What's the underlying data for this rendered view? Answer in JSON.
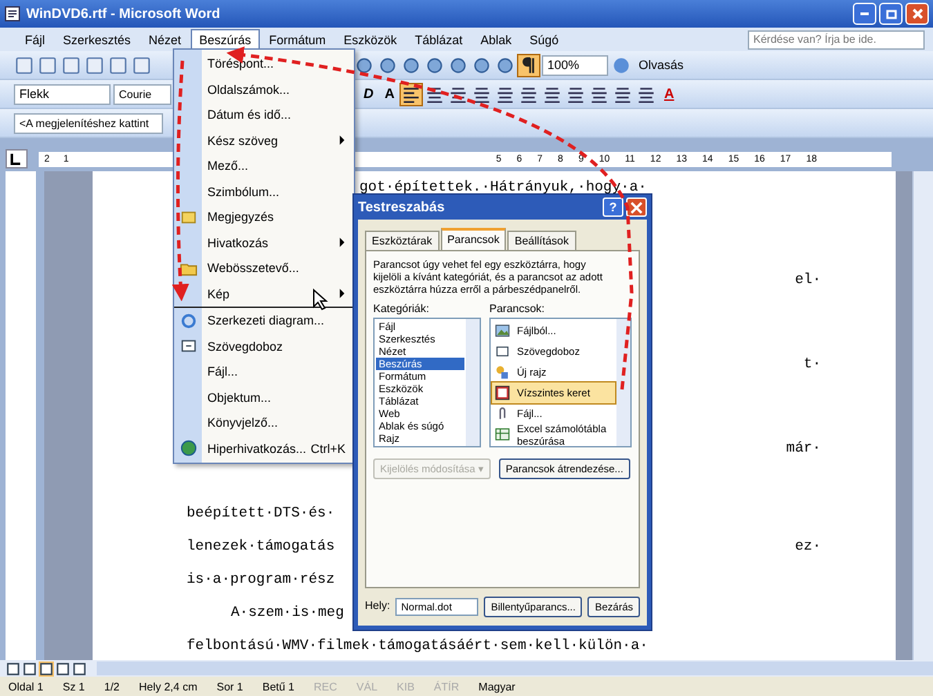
{
  "window": {
    "title": "WinDVD6.rtf - Microsoft Word"
  },
  "menu_bar": {
    "items": [
      {
        "label": "Fájl",
        "selected": false
      },
      {
        "label": "Szerkesztés",
        "selected": false
      },
      {
        "label": "Nézet",
        "selected": false
      },
      {
        "label": "Beszúrás",
        "selected": true
      },
      {
        "label": "Formátum",
        "selected": false
      },
      {
        "label": "Eszközök",
        "selected": false
      },
      {
        "label": "Táblázat",
        "selected": false
      },
      {
        "label": "Ablak",
        "selected": false
      },
      {
        "label": "Súgó",
        "selected": false
      }
    ],
    "ask_box": {
      "placeholder": "Kérdése van? Írja be ide."
    }
  },
  "standard_toolbar": {
    "zoom": "100%",
    "reading_button": "Olvasás",
    "show_marks_on": true
  },
  "formatting_toolbar": {
    "style": "Flekk",
    "font": "Courie",
    "italic": "D",
    "underline": "A",
    "align_left_on": true,
    "font_color": "A"
  },
  "toolbar_3": {
    "field": "<A megjelenítéshez kattint"
  },
  "ruler": {
    "left_labels": [
      "2",
      "1"
    ],
    "right_labels": [
      "5",
      "6",
      "7",
      "8",
      "9",
      "10",
      "11",
      "12",
      "13",
      "14",
      "15",
      "16",
      "17",
      "18"
    ]
  },
  "document": {
    "first_line": "got·építettek.·Hátrányuk,·hogy·a·",
    "right_fragments": [
      "el·",
      "t·",
      "már·"
    ],
    "lines": [
      {
        "kind": "text",
        "text": "beépített·DTS·és·"
      },
      {
        "kind": "text",
        "text": "lenezek·támogatás",
        "tail": "ez·"
      },
      {
        "kind": "text",
        "text": "is·a·program·rész"
      },
      {
        "kind": "indent",
        "text": "A·szem·is·meg"
      },
      {
        "kind": "text",
        "text": "felbontású·WMV·filmek·támogatásáért·sem·kell·külön·a·"
      }
    ]
  },
  "insert_menu": {
    "items": [
      {
        "label": "Töréspont...",
        "submenu": false
      },
      {
        "label": "Oldalszámok...",
        "submenu": false
      },
      {
        "label": "Dátum és idő...",
        "submenu": false
      },
      {
        "label": "Kész szöveg",
        "submenu": true
      },
      {
        "label": "Mező...",
        "submenu": false
      },
      {
        "label": "Szimbólum...",
        "submenu": false
      },
      {
        "label": "Megjegyzés",
        "submenu": false
      },
      {
        "label": "Hivatkozás",
        "submenu": true
      },
      {
        "label": "Webösszetevő...",
        "submenu": false
      },
      {
        "label": "Kép",
        "submenu": true
      },
      {
        "label": "Szerkezeti diagram...",
        "submenu": false
      },
      {
        "label": "Szövegdoboz",
        "submenu": false
      },
      {
        "label": "Fájl...",
        "submenu": false
      },
      {
        "label": "Objektum...",
        "submenu": false
      },
      {
        "label": "Könyvjelző...",
        "submenu": false
      },
      {
        "label": "Hiperhivatkozás...",
        "submenu": false,
        "shortcut": "Ctrl+K"
      }
    ]
  },
  "dialog": {
    "title": "Testreszabás",
    "help_button": "?",
    "tabs": [
      {
        "label": "Eszköztárak",
        "selected": false
      },
      {
        "label": "Parancsok",
        "selected": true
      },
      {
        "label": "Beállítások",
        "selected": false
      }
    ],
    "instructions": "Parancsot úgy vehet fel egy eszköztárra, hogy kijelöli a kívánt kategóriát, és a parancsot az adott eszköztárra húzza erről a párbeszédpanelről.",
    "categories_label": "Kategóriák:",
    "categories": [
      {
        "label": "Fájl",
        "selected": false
      },
      {
        "label": "Szerkesztés",
        "selected": false
      },
      {
        "label": "Nézet",
        "selected": false
      },
      {
        "label": "Beszúrás",
        "selected": true
      },
      {
        "label": "Formátum",
        "selected": false
      },
      {
        "label": "Eszközök",
        "selected": false
      },
      {
        "label": "Táblázat",
        "selected": false
      },
      {
        "label": "Web",
        "selected": false
      },
      {
        "label": "Ablak és súgó",
        "selected": false
      },
      {
        "label": "Rajz",
        "selected": false
      }
    ],
    "commands_label": "Parancsok:",
    "commands": [
      {
        "label": "Fájlból...",
        "selected": false
      },
      {
        "label": "Szövegdoboz",
        "selected": false
      },
      {
        "label": "Új rajz",
        "selected": false
      },
      {
        "label": "Vízszintes keret",
        "selected": true
      },
      {
        "label": "Fájl...",
        "selected": false
      },
      {
        "label": "Excel számolótábla beszúrása",
        "selected": false
      }
    ],
    "modify_button": {
      "label": "Kijelölés módosítása ▾",
      "disabled": true
    },
    "rearrange_button": "Parancsok átrendezése...",
    "location_label": "Hely:",
    "location_value": "Normal.dot",
    "keyboard_button": "Billentyűparancs...",
    "close_button": "Bezárás"
  },
  "status_bar": {
    "items": [
      {
        "label": "Oldal 1",
        "disabled": false
      },
      {
        "label": "Sz 1",
        "disabled": false
      },
      {
        "label": "1/2",
        "disabled": false
      },
      {
        "label": "Hely 2,4 cm",
        "disabled": false
      },
      {
        "label": "Sor 1",
        "disabled": false
      },
      {
        "label": "Betű 1",
        "disabled": false
      },
      {
        "label": "REC",
        "disabled": true
      },
      {
        "label": "VÁL",
        "disabled": true
      },
      {
        "label": "KIB",
        "disabled": true
      },
      {
        "label": "ÁTÍR",
        "disabled": true
      },
      {
        "label": "Magyar",
        "disabled": false
      }
    ]
  }
}
